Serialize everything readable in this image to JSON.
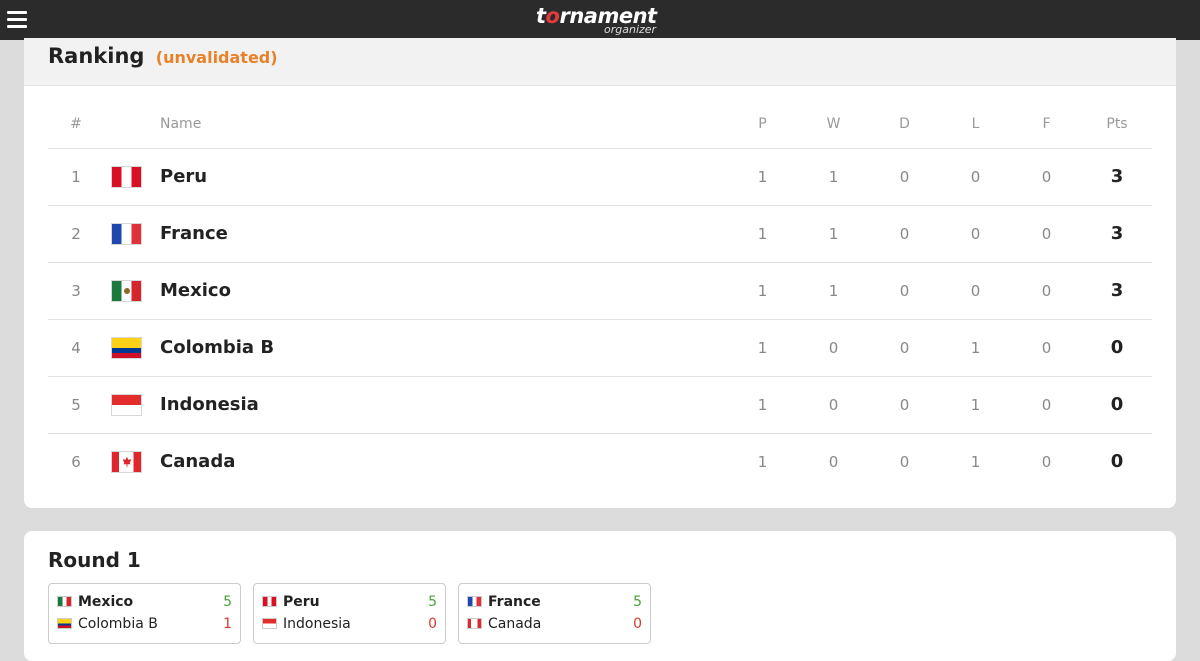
{
  "app": {
    "logo_main_a": "t",
    "logo_main_ring": "o",
    "logo_main_b": "rnament",
    "logo_sub": "organizer"
  },
  "ranking": {
    "title": "Ranking",
    "status": "(unvalidated)",
    "columns": [
      "#",
      "Name",
      "P",
      "W",
      "D",
      "L",
      "F",
      "Pts"
    ],
    "rows": [
      {
        "rank": "1",
        "flag": "peru-flag-icon",
        "name": "Peru",
        "p": "1",
        "w": "1",
        "d": "0",
        "l": "0",
        "f": "0",
        "pts": "3"
      },
      {
        "rank": "2",
        "flag": "france-flag-icon",
        "name": "France",
        "p": "1",
        "w": "1",
        "d": "0",
        "l": "0",
        "f": "0",
        "pts": "3"
      },
      {
        "rank": "3",
        "flag": "mexico-flag-icon",
        "name": "Mexico",
        "p": "1",
        "w": "1",
        "d": "0",
        "l": "0",
        "f": "0",
        "pts": "3"
      },
      {
        "rank": "4",
        "flag": "colombia-flag-icon",
        "name": "Colombia B",
        "p": "1",
        "w": "0",
        "d": "0",
        "l": "1",
        "f": "0",
        "pts": "0"
      },
      {
        "rank": "5",
        "flag": "indonesia-flag-icon",
        "name": "Indonesia",
        "p": "1",
        "w": "0",
        "d": "0",
        "l": "1",
        "f": "0",
        "pts": "0"
      },
      {
        "rank": "6",
        "flag": "canada-flag-icon",
        "name": "Canada",
        "p": "1",
        "w": "0",
        "d": "0",
        "l": "1",
        "f": "0",
        "pts": "0"
      }
    ]
  },
  "round": {
    "title": "Round 1",
    "matches": [
      {
        "home": {
          "name": "Mexico",
          "score": "5"
        },
        "away": {
          "name": "Colombia B",
          "score": "1"
        }
      },
      {
        "home": {
          "name": "Peru",
          "score": "5"
        },
        "away": {
          "name": "Indonesia",
          "score": "0"
        }
      },
      {
        "home": {
          "name": "France",
          "score": "5"
        },
        "away": {
          "name": "Canada",
          "score": "0"
        }
      }
    ]
  },
  "colors": {
    "topbar": "#2b2b2b",
    "status": "#e8822a",
    "win_score": "#4aa33b",
    "lose_score": "#d93a2f"
  }
}
